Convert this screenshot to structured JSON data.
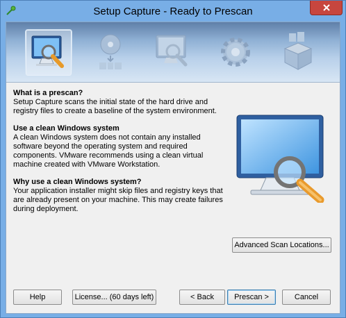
{
  "window": {
    "title": "Setup Capture - Ready to Prescan"
  },
  "steps": [
    {
      "name": "prescan",
      "icon": "monitor-magnifier-icon",
      "active": true
    },
    {
      "name": "install",
      "icon": "disc-install-icon",
      "active": false
    },
    {
      "name": "postscan",
      "icon": "monitor-icon",
      "active": false
    },
    {
      "name": "configure",
      "icon": "gear-icon",
      "active": false
    },
    {
      "name": "package",
      "icon": "package-box-icon",
      "active": false
    }
  ],
  "sections": [
    {
      "heading": "What is a prescan?",
      "body": "Setup Capture scans the initial state of the hard drive and registry files to create a baseline of the system environment."
    },
    {
      "heading": "Use a clean Windows system",
      "body": "A clean Windows system does not contain any installed software beyond the operating system and required components. VMware recommends using a clean virtual machine created with VMware Workstation."
    },
    {
      "heading": "Why use a clean Windows system?",
      "body": "Your application installer might skip files and registry keys that are already present on your machine. This may create failures during deployment."
    }
  ],
  "buttons": {
    "advanced": "Advanced Scan Locations...",
    "help": "Help",
    "license": "License... (60 days left)",
    "back": "< Back",
    "prescan": "Prescan >",
    "cancel": "Cancel"
  },
  "colors": {
    "frame": "#78aee6",
    "close": "#c7463e",
    "accent": "#3c7fb1"
  }
}
